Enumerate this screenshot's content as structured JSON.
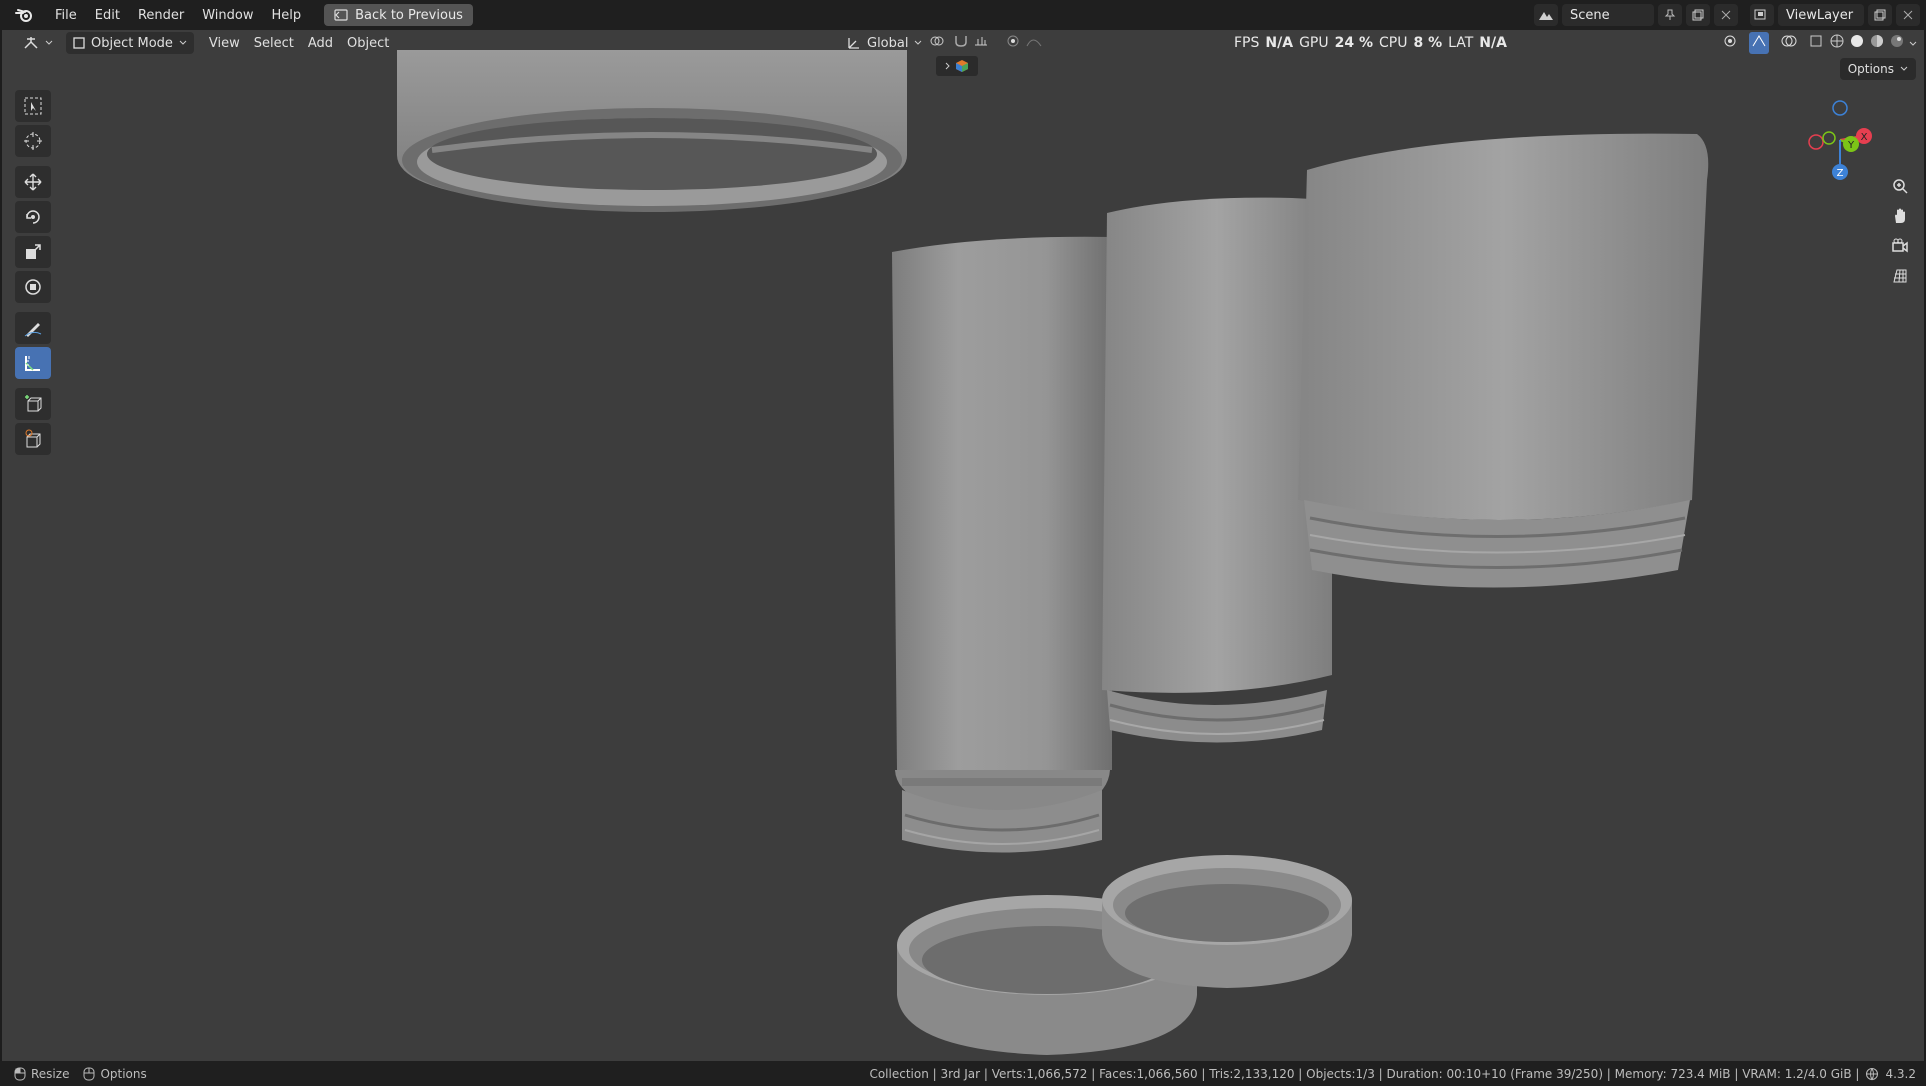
{
  "menubar": {
    "items": [
      "File",
      "Edit",
      "Render",
      "Window",
      "Help"
    ],
    "back_button": "Back to Previous",
    "scene": "Scene",
    "view_layer": "ViewLayer"
  },
  "viewport_header": {
    "mode": "Object Mode",
    "menus": [
      "View",
      "Select",
      "Add",
      "Object"
    ],
    "orientation": "Global",
    "options": "Options"
  },
  "stats": {
    "fps_label": "FPS",
    "fps_value": "N/A",
    "gpu_label": "GPU",
    "gpu_value": "24 %",
    "cpu_label": "CPU",
    "cpu_value": "8 %",
    "lat_label": "LAT",
    "lat_value": "N/A"
  },
  "gizmo": {
    "x": "X",
    "y": "Y",
    "z": "Z"
  },
  "statusbar": {
    "resize": "Resize",
    "options": "Options",
    "info": "Collection | 3rd Jar | Verts:1,066,572 | Faces:1,066,560 | Tris:2,133,120 | Objects:1/3 | Duration: 00:10+10 (Frame 39/250) | Memory: 723.4 MiB | VRAM: 1.2/4.0 GiB |",
    "version": "4.3.2"
  },
  "colors": {
    "viewport_bg": "#3d3d3d",
    "active_tool": "#4772b3",
    "axis_x": "#e63f50",
    "axis_y": "#7cc517",
    "axis_z": "#3d82d7"
  }
}
